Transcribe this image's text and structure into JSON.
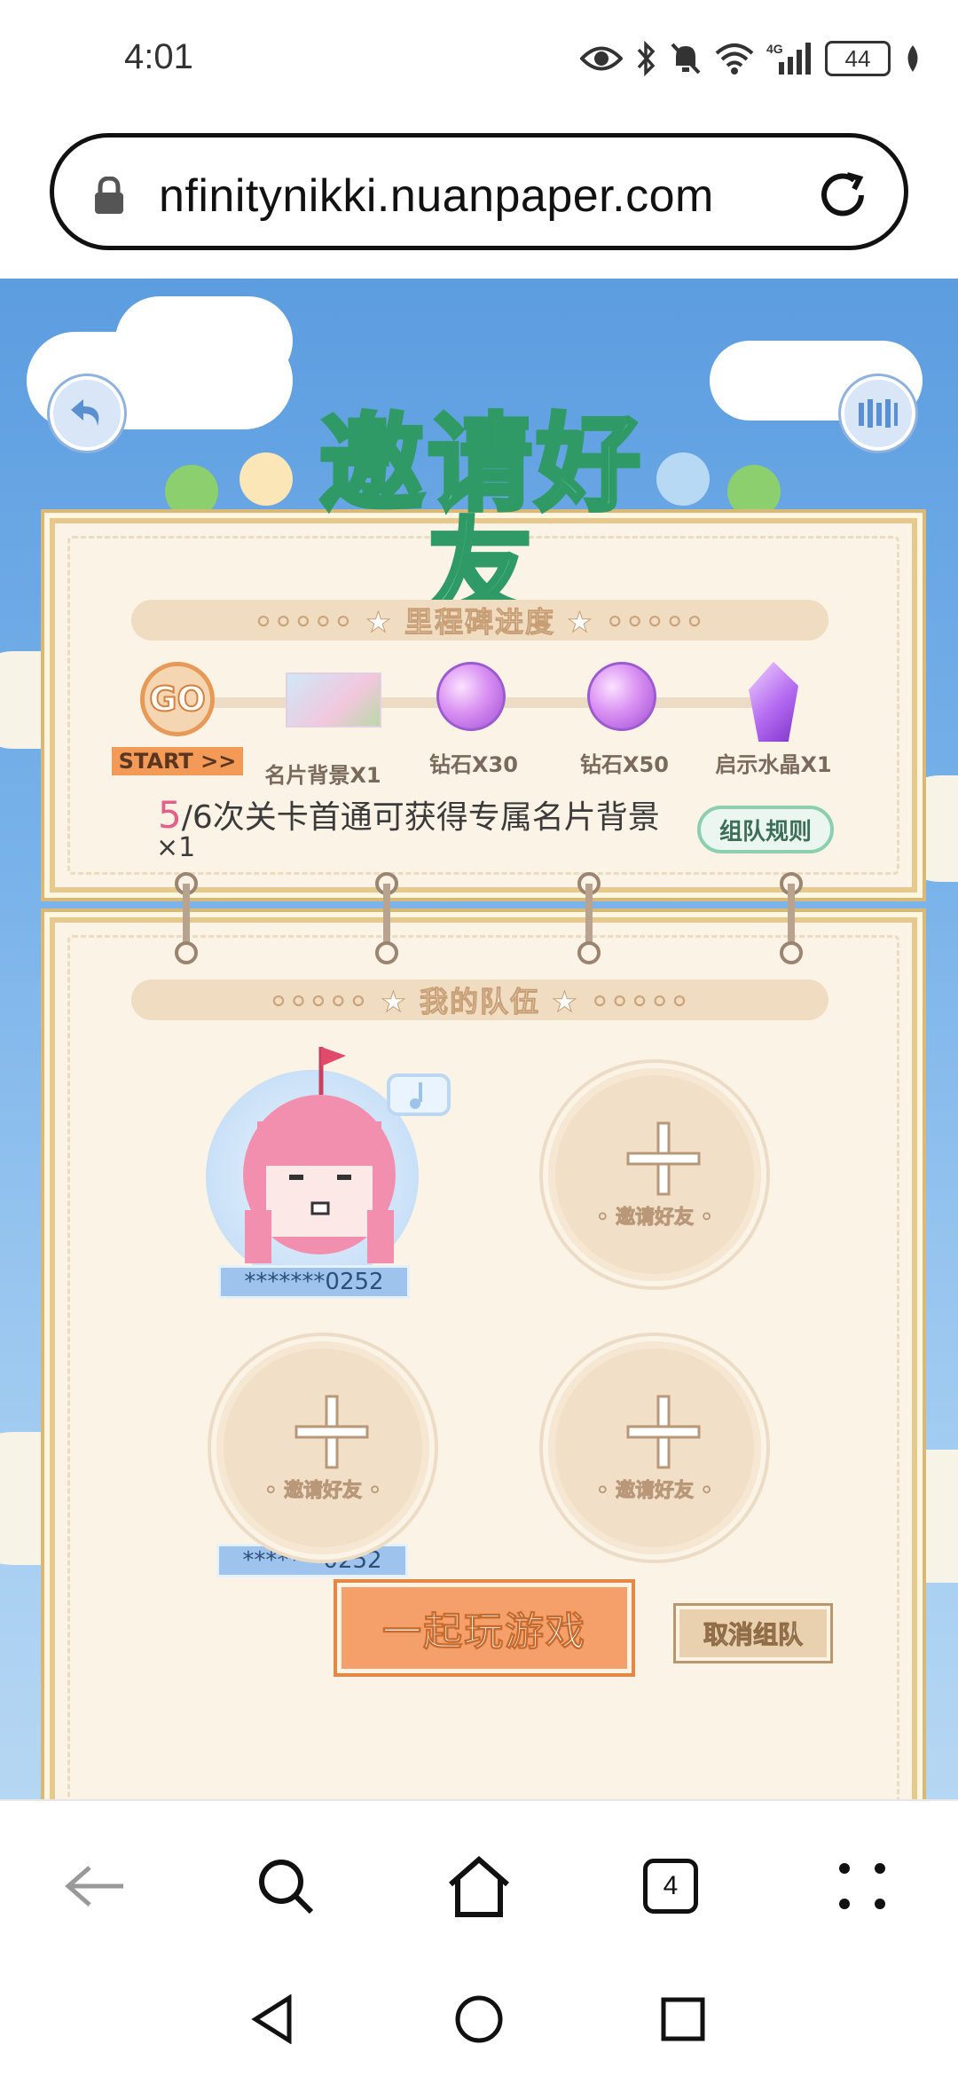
{
  "status_bar": {
    "time": "4:01",
    "battery": "44"
  },
  "browser": {
    "url": "nfinitynikki.nuanpaper.com",
    "tab_count": "4"
  },
  "game": {
    "title": "邀请好友",
    "milestone_header": "◦◦◦◦◦ ★ 里程碑进度 ★ ◦◦◦◦◦",
    "milestones": [
      {
        "label": "START >>",
        "icon": "go-badge-icon"
      },
      {
        "label": "名片背景X1",
        "icon": "namecard-icon"
      },
      {
        "label": "钻石X30",
        "icon": "diamond-icon"
      },
      {
        "label": "钻石X50",
        "icon": "diamond-icon"
      },
      {
        "label": "启示水晶X1",
        "icon": "crystal-icon"
      }
    ],
    "go_text": "GO",
    "progress_count": "5",
    "progress_text": "/6次关卡首通可获得专属名片背景",
    "progress_multiplier": "×1",
    "rule_button": "组队规则",
    "team_header": "◦◦◦◦◦ ★ 我的队伍 ★ ◦◦◦◦◦",
    "member_name": "*******0252",
    "invite_label": "◦ 邀请好友 ◦",
    "play_button": "一起玩游戏",
    "cancel_button": "取消组队"
  },
  "colors": {
    "title_green": "#6fd19a",
    "accent_orange": "#f5a06a",
    "panel_cream": "#fbf3e6",
    "sky_blue": "#5c9de0"
  }
}
